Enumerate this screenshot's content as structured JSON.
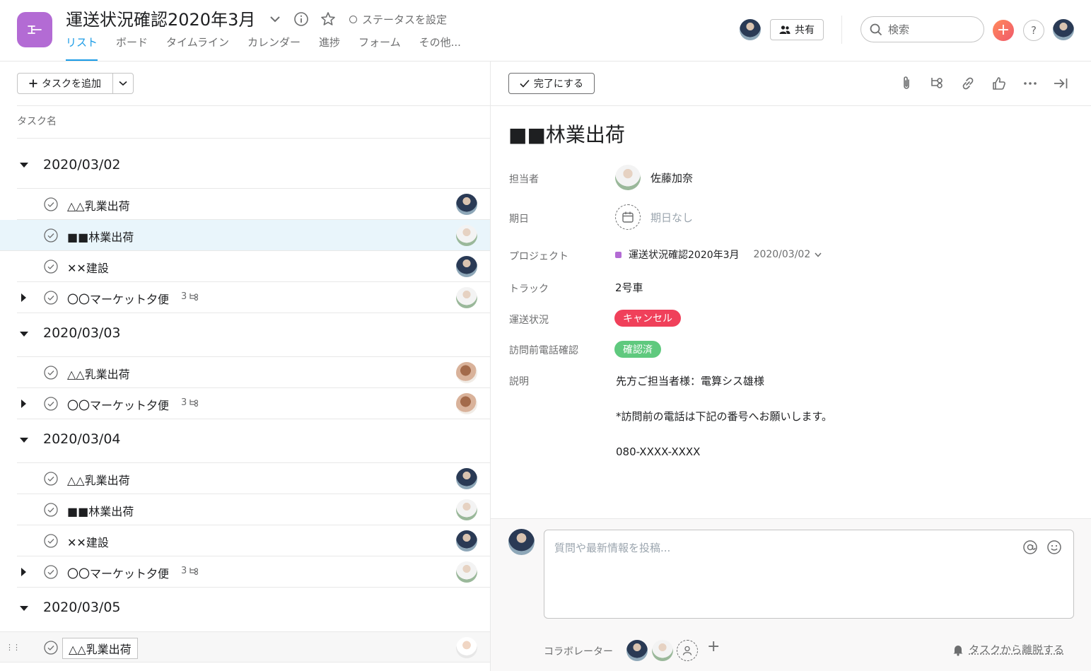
{
  "header": {
    "project_title": "運送状況確認2020年3月",
    "status_label": "ステータスを設定",
    "tabs": [
      "リスト",
      "ボード",
      "タイムライン",
      "カレンダー",
      "進捗",
      "フォーム",
      "その他..."
    ],
    "share_label": "共有",
    "search_placeholder": "検索",
    "help_label": "?",
    "plus_label": "+",
    "project_color": "#b36bd4",
    "active_tab_color": "#1a9be6"
  },
  "list": {
    "add_task_label": "タスクを追加",
    "column_header": "タスク名",
    "sections": [
      {
        "title": "2020/03/02",
        "tasks": [
          {
            "name": "△△乳業出荷",
            "subtasks": ""
          },
          {
            "name": "■■林業出荷",
            "subtasks": ""
          },
          {
            "name": "✕✕建設",
            "subtasks": ""
          },
          {
            "name": "〇〇マーケット夕便",
            "subtasks": "3"
          }
        ]
      },
      {
        "title": "2020/03/03",
        "tasks": [
          {
            "name": "△△乳業出荷",
            "subtasks": ""
          },
          {
            "name": "〇〇マーケット夕便",
            "subtasks": "3"
          }
        ]
      },
      {
        "title": "2020/03/04",
        "tasks": [
          {
            "name": "△△乳業出荷",
            "subtasks": ""
          },
          {
            "name": "■■林業出荷",
            "subtasks": ""
          },
          {
            "name": "✕✕建設",
            "subtasks": ""
          },
          {
            "name": "〇〇マーケット夕便",
            "subtasks": "3"
          }
        ]
      },
      {
        "title": "2020/03/05",
        "tasks": [
          {
            "name": "△△乳業出荷",
            "subtasks": ""
          }
        ]
      }
    ]
  },
  "detail": {
    "complete_label": "完了にする",
    "title": "■■林業出荷",
    "fields": {
      "assignee_label": "担当者",
      "assignee": "佐藤加奈",
      "due_label": "期日",
      "due": "期日なし",
      "project_label": "プロジェクト",
      "project": "運送状況確認2020年3月",
      "project_section": "2020/03/02",
      "truck_label": "トラック",
      "truck": "2号車",
      "shipping_label": "運送状況",
      "shipping": "キャンセル",
      "shipping_color": "#f0405a",
      "call_label": "訪問前電話確認",
      "call": "確認済",
      "call_color": "#5fc97e",
      "desc_label": "説明"
    },
    "description": [
      "先方ご担当者様：電算シス雄様",
      "",
      "*訪問前の電話は下記の番号へお願いします。",
      "",
      "080-XXXX-XXXX"
    ],
    "comment_placeholder": "質問や最新情報を投稿...",
    "collaborators_label": "コラボレーター",
    "leave_label": "タスクから離脱する"
  }
}
